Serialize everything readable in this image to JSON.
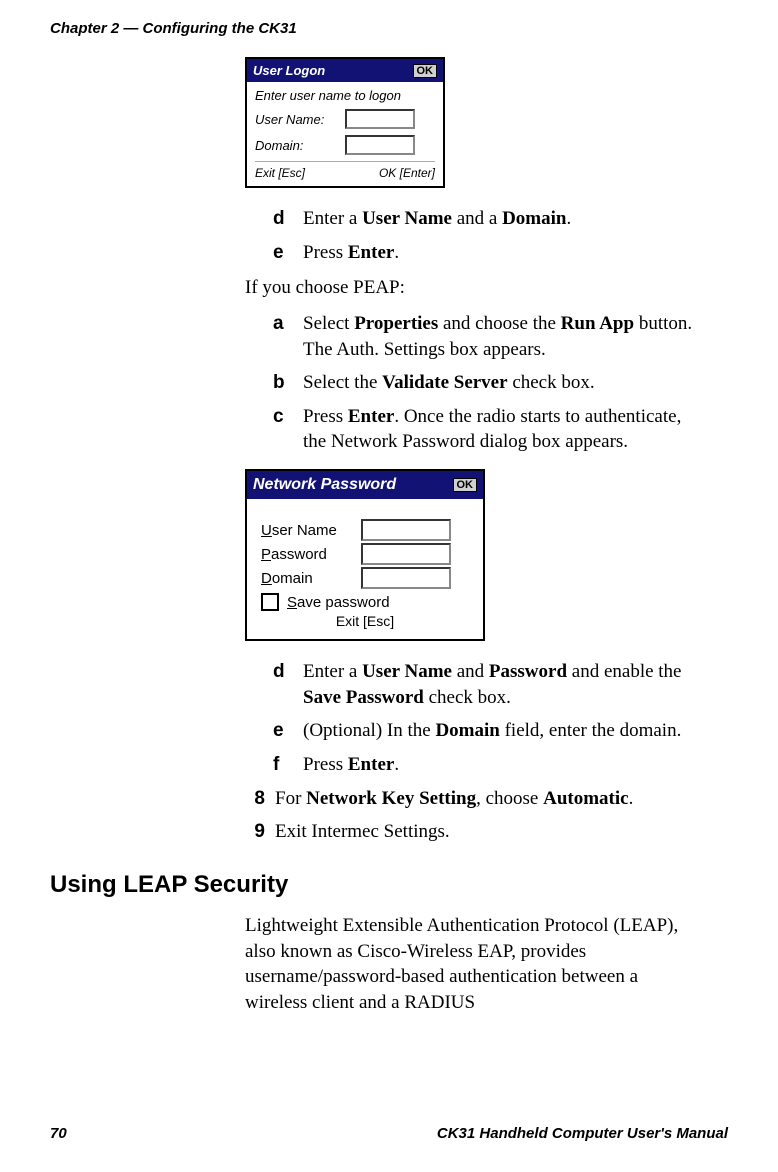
{
  "header": "Chapter 2 — Configuring the CK31",
  "dialog1": {
    "title": "User Logon",
    "ok_btn": "OK",
    "prompt": "Enter user name to logon",
    "user_name_label": "User Name:",
    "domain_label": "Domain:",
    "exit_text": "Exit [Esc]",
    "ok_text": "OK [Enter]"
  },
  "steps1": {
    "d": {
      "marker": "d",
      "pre": "Enter a ",
      "b1": "User Name",
      "mid": " and a ",
      "b2": "Domain",
      "post": "."
    },
    "e": {
      "marker": "e",
      "pre": "Press ",
      "b1": "Enter",
      "post": "."
    }
  },
  "peap_intro": "If you choose PEAP:",
  "steps2": {
    "a": {
      "marker": "a",
      "pre": "Select ",
      "b1": "Properties",
      "mid": " and choose the ",
      "b2": "Run App",
      "post": " button. The Auth. Settings box appears."
    },
    "b": {
      "marker": "b",
      "pre": "Select the ",
      "b1": "Validate Server",
      "post": " check box."
    },
    "c": {
      "marker": "c",
      "pre": "Press ",
      "b1": "Enter",
      "post": ". Once the radio starts to authenticate, the Network Password dialog box appears."
    }
  },
  "dialog2": {
    "title": "Network Password",
    "ok_btn": "OK",
    "user_name_label_pre": "U",
    "user_name_label_rest": "ser Name",
    "password_label_pre": "P",
    "password_label_rest": "assword",
    "domain_label_pre": "D",
    "domain_label_rest": "omain",
    "save_pre": "S",
    "save_rest": "ave password",
    "exit_text": "Exit [Esc]"
  },
  "steps3": {
    "d": {
      "marker": "d",
      "pre": "Enter a ",
      "b1": "User Name",
      "mid1": " and ",
      "b2": "Password",
      "mid2": " and enable the ",
      "b3": "Save Password",
      "post": " check box."
    },
    "e": {
      "marker": "e",
      "pre": " (Optional) In the ",
      "b1": "Domain",
      "post": " field, enter the domain."
    },
    "f": {
      "marker": "f",
      "pre": "Press ",
      "b1": "Enter",
      "post": "."
    }
  },
  "steps4": {
    "s8": {
      "marker": "8",
      "pre": "For ",
      "b1": "Network Key Setting",
      "mid": ", choose ",
      "b2": "Automatic",
      "post": "."
    },
    "s9": {
      "marker": "9",
      "text": "Exit Intermec Settings."
    }
  },
  "heading": "Using LEAP Security",
  "leap_para": "Lightweight Extensible Authentication Protocol (LEAP), also known as Cisco-Wireless EAP, provides username/password-based authentication between a wireless client and a RADIUS",
  "footer": {
    "page": "70",
    "title": "CK31 Handheld Computer User's Manual"
  }
}
